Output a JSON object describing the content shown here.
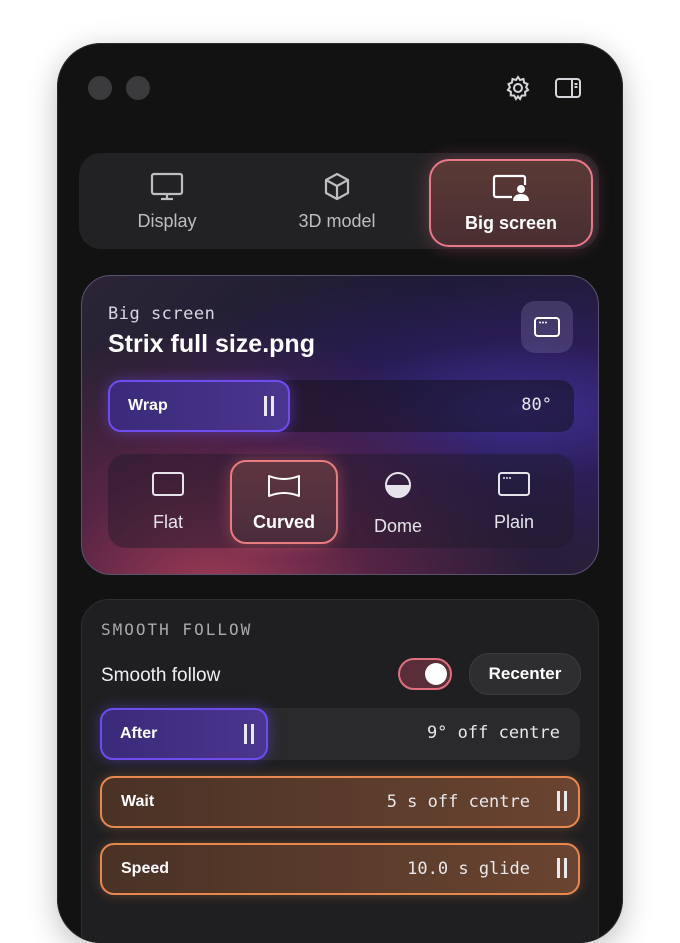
{
  "window": {
    "settings_icon": "gear-icon",
    "sidebar_icon": "sidebar-toggle-icon"
  },
  "modes": [
    {
      "label": "Display",
      "icon": "monitor-icon",
      "active": false
    },
    {
      "label": "3D model",
      "icon": "cube-icon",
      "active": false
    },
    {
      "label": "Big screen",
      "icon": "big-screen-person-icon",
      "active": true
    }
  ],
  "big_screen": {
    "subtitle": "Big screen",
    "file_name": "Strix full size.png",
    "window_button_icon": "window-icon",
    "wrap": {
      "label": "Wrap",
      "value": "80°"
    },
    "shapes": [
      {
        "label": "Flat",
        "icon": "flat-screen-icon",
        "active": false
      },
      {
        "label": "Curved",
        "icon": "curved-screen-icon",
        "active": true
      },
      {
        "label": "Dome",
        "icon": "dome-icon",
        "active": false
      },
      {
        "label": "Plain",
        "icon": "plain-window-icon",
        "active": false
      }
    ]
  },
  "smooth_follow": {
    "heading": "SMOOTH FOLLOW",
    "label": "Smooth follow",
    "enabled": true,
    "recenter_label": "Recenter",
    "after": {
      "label": "After",
      "value": "9° off centre"
    },
    "wait": {
      "label": "Wait",
      "value": "5 s off centre"
    },
    "speed": {
      "label": "Speed",
      "value": "10.0 s glide"
    }
  },
  "colors": {
    "accent_purple": "#6f4cf0",
    "accent_pink": "#e8798a",
    "accent_orange": "#e8884f"
  }
}
